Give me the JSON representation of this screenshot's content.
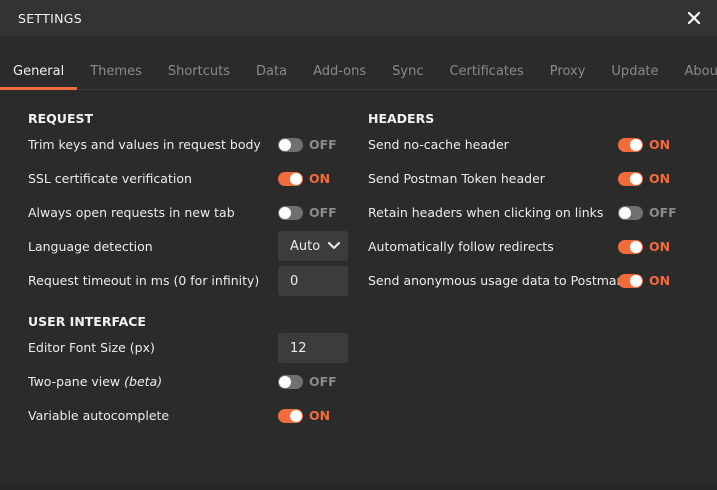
{
  "window": {
    "title": "SETTINGS"
  },
  "tabs": [
    "General",
    "Themes",
    "Shortcuts",
    "Data",
    "Add-ons",
    "Sync",
    "Certificates",
    "Proxy",
    "Update",
    "About"
  ],
  "active_tab": "General",
  "request": {
    "title": "REQUEST",
    "trim_label": "Trim keys and values in request body",
    "trim_state": "OFF",
    "ssl_label": "SSL certificate verification",
    "ssl_state": "ON",
    "newtab_label": "Always open requests in new tab",
    "newtab_state": "OFF",
    "lang_label": "Language detection",
    "lang_value": "Auto",
    "timeout_label": "Request timeout in ms (0 for infinity)",
    "timeout_value": "0"
  },
  "ui": {
    "title": "USER INTERFACE",
    "font_label": "Editor Font Size (px)",
    "font_value": "12",
    "twopane_label": "Two-pane view",
    "twopane_beta": "(beta)",
    "twopane_state": "OFF",
    "autocomplete_label": "Variable autocomplete",
    "autocomplete_state": "ON"
  },
  "headers": {
    "title": "HEADERS",
    "nocache_label": "Send no-cache header",
    "nocache_state": "ON",
    "token_label": "Send Postman Token header",
    "token_state": "ON",
    "retain_label": "Retain headers when clicking on links",
    "retain_state": "OFF",
    "redirect_label": "Automatically follow redirects",
    "redirect_state": "ON",
    "anon_label": "Send anonymous usage data to Postman",
    "anon_state": "ON"
  },
  "colors": {
    "accent": "#f26b3a",
    "background": "#2b2b2b",
    "titlebar": "#333333",
    "field": "#3c3c3c"
  },
  "icons": {
    "close": "close-icon",
    "dropdown": "chevron-down-icon"
  }
}
